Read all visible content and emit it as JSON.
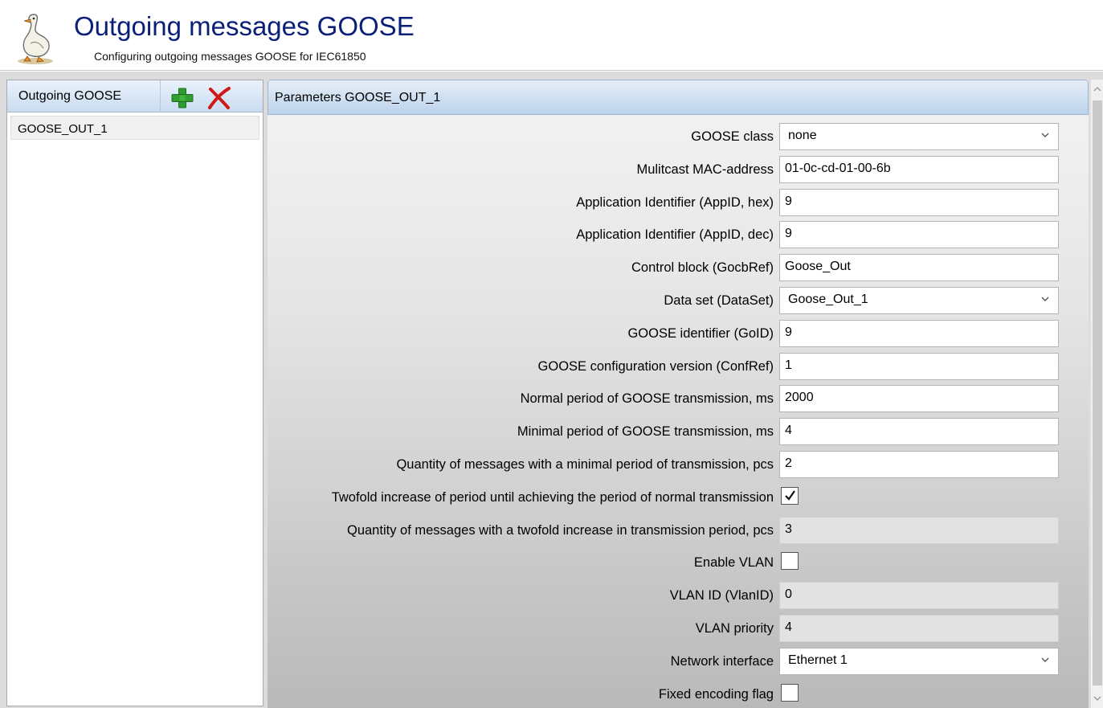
{
  "header": {
    "title": "Outgoing messages GOOSE",
    "subtitle": "Configuring outgoing messages GOOSE for IEC61850",
    "logo_icon": "goose-logo-icon"
  },
  "left_panel": {
    "title": "Outgoing GOOSE",
    "add_icon": "plus-icon",
    "delete_icon": "x-delete-icon",
    "items": [
      "GOOSE_OUT_1"
    ]
  },
  "right_panel": {
    "title": "Parameters GOOSE_OUT_1",
    "fields": [
      {
        "label": "GOOSE class",
        "type": "select",
        "value": "none",
        "enabled": true
      },
      {
        "label": "Mulitcast MAC-address",
        "type": "text",
        "value": "01-0c-cd-01-00-6b",
        "enabled": true
      },
      {
        "label": "Application Identifier (AppID, hex)",
        "type": "text",
        "value": "9",
        "enabled": true
      },
      {
        "label": "Application Identifier (AppID, dec)",
        "type": "text",
        "value": "9",
        "enabled": true
      },
      {
        "label": "Control block (GocbRef)",
        "type": "text",
        "value": "Goose_Out",
        "enabled": true
      },
      {
        "label": "Data set (DataSet)",
        "type": "select",
        "value": "Goose_Out_1",
        "enabled": true
      },
      {
        "label": "GOOSE identifier (GoID)",
        "type": "text",
        "value": "9",
        "enabled": true
      },
      {
        "label": "GOOSE configuration version (ConfRef)",
        "type": "text",
        "value": "1",
        "enabled": true
      },
      {
        "label": "Normal period of GOOSE transmission, ms",
        "type": "text",
        "value": "2000",
        "enabled": true
      },
      {
        "label": "Minimal period of GOOSE transmission, ms",
        "type": "text",
        "value": "4",
        "enabled": true
      },
      {
        "label": "Quantity of messages with a minimal period of transmission, pcs",
        "type": "text",
        "value": "2",
        "enabled": true
      },
      {
        "label": "Twofold increase of period until achieving the period of normal transmission",
        "type": "checkbox",
        "checked": true,
        "enabled": true
      },
      {
        "label": "Quantity of messages with a twofold increase in transmission period, pcs",
        "type": "text",
        "value": "3",
        "enabled": false
      },
      {
        "label": "Enable VLAN",
        "type": "checkbox",
        "checked": false,
        "enabled": true
      },
      {
        "label": "VLAN ID (VlanID)",
        "type": "text",
        "value": "0",
        "enabled": false
      },
      {
        "label": "VLAN priority",
        "type": "text",
        "value": "4",
        "enabled": false
      },
      {
        "label": "Network interface",
        "type": "select",
        "value": "Ethernet 1",
        "enabled": true
      },
      {
        "label": "Fixed encoding flag",
        "type": "checkbox",
        "checked": false,
        "enabled": true
      }
    ]
  },
  "colors": {
    "title": "#0a1f78",
    "header_gradient_top": "#e6eef8",
    "header_gradient_bottom": "#bcd3ec",
    "plus_green": "#2f9d2f",
    "delete_red": "#d01818"
  }
}
